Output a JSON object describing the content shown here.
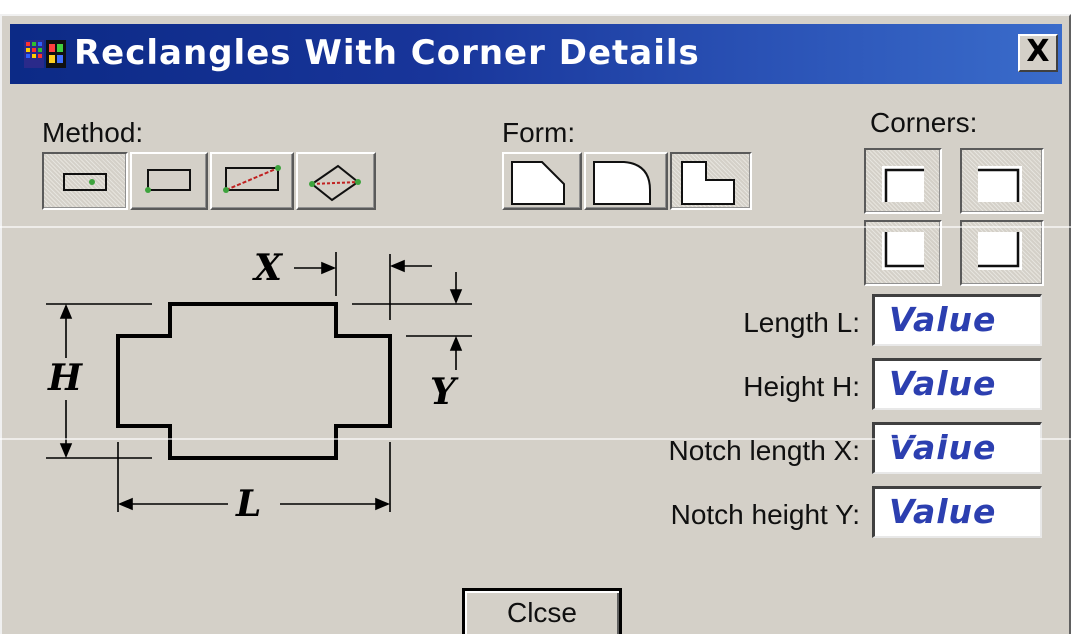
{
  "window": {
    "title": "Reclangles With Corner Details",
    "close_glyph": "X"
  },
  "method": {
    "label": "Method:",
    "buttons": [
      {
        "icon": "rectangle-center-method-icon",
        "selected": true
      },
      {
        "icon": "rectangle-corner-method-icon",
        "selected": false
      },
      {
        "icon": "rectangle-diagonal-method-icon",
        "selected": false
      },
      {
        "icon": "rectangle-rotated-method-icon",
        "selected": false
      }
    ]
  },
  "form": {
    "label": "Form:",
    "buttons": [
      {
        "icon": "chamfer-form-icon",
        "selected": false
      },
      {
        "icon": "round-form-icon",
        "selected": false
      },
      {
        "icon": "notch-form-icon",
        "selected": true
      }
    ]
  },
  "corners": {
    "label": "Corners:",
    "buttons": [
      {
        "icon": "top-left-corner-icon",
        "selected": true
      },
      {
        "icon": "top-right-corner-icon",
        "selected": true
      },
      {
        "icon": "bottom-left-corner-icon",
        "selected": true
      },
      {
        "icon": "bottom-right-corner-icon",
        "selected": true
      }
    ]
  },
  "fields": [
    {
      "label": "Length L:",
      "value": "Value"
    },
    {
      "label": "Height H:",
      "value": "Value"
    },
    {
      "label": "Notch length X:",
      "value": "Value"
    },
    {
      "label": "Notch height Y:",
      "value": "Value"
    }
  ],
  "diagram": {
    "letters": {
      "x": "X",
      "y": "Y",
      "h": "H",
      "l": "L"
    }
  },
  "close_button": {
    "label": "Clcse"
  },
  "colors": {
    "title_bar": "#0c2a86",
    "value_text": "#2c3fb0",
    "dialog_bg": "#d4d0c8",
    "icon_green": "#3da33d",
    "icon_red": "#c02020"
  }
}
